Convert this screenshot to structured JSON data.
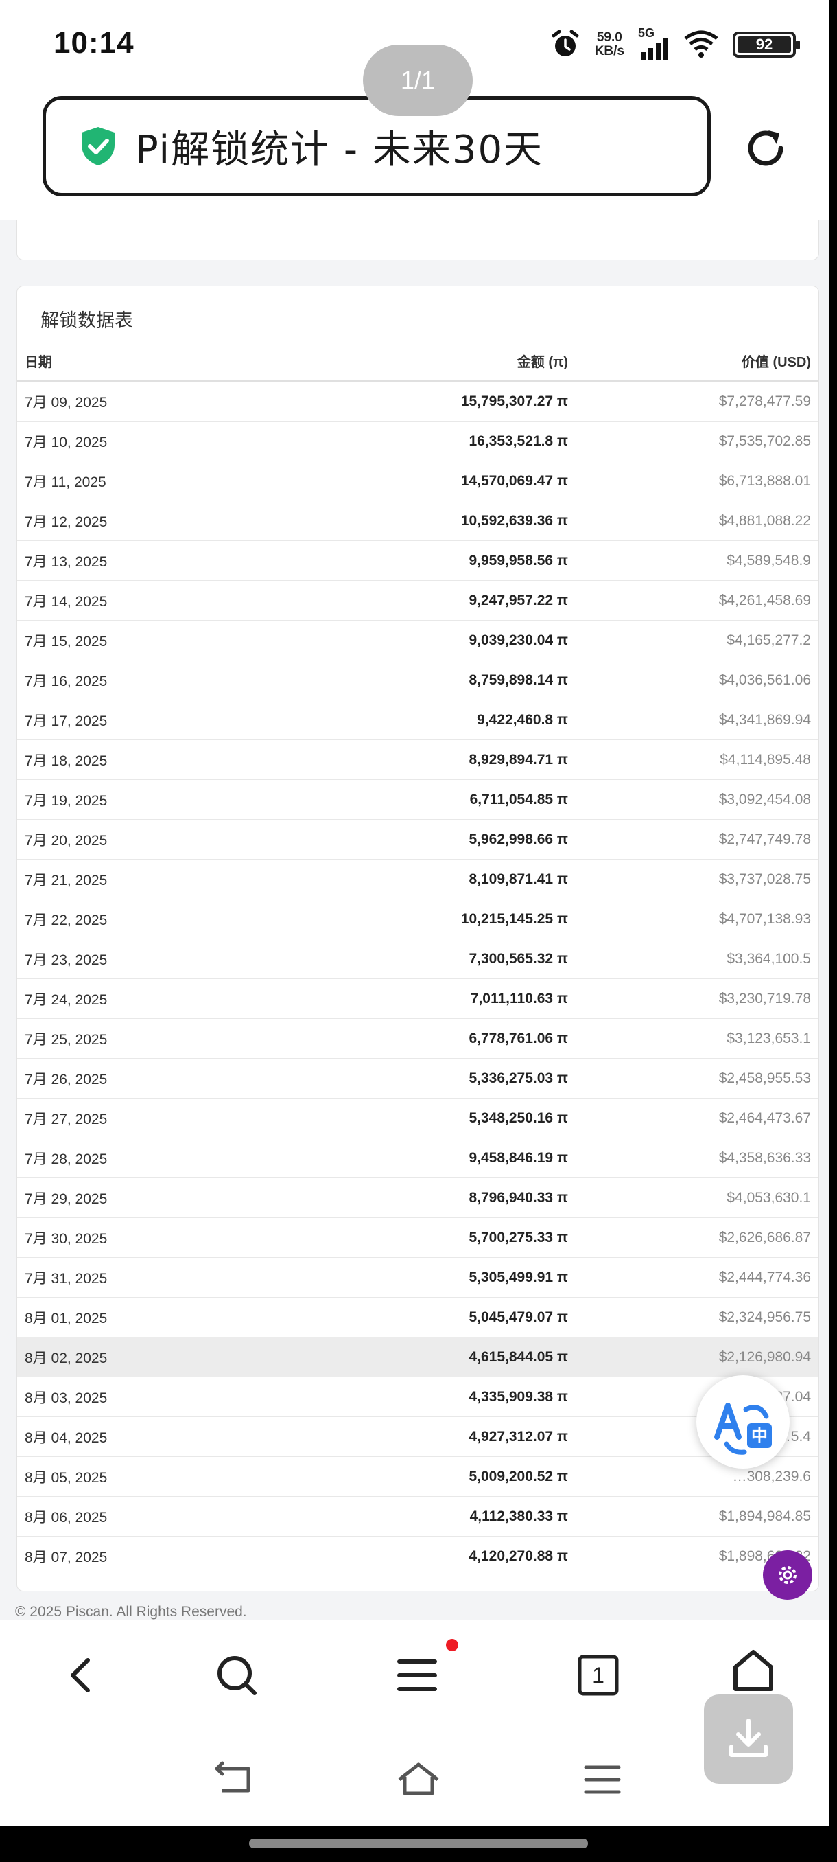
{
  "status_bar": {
    "time": "10:14",
    "net_speed_value": "59.0",
    "net_speed_unit": "KB/s",
    "network": "5G",
    "battery": "92"
  },
  "browser": {
    "page_counter": "1/1",
    "title": "Pi解锁统计 - 未来30天"
  },
  "table": {
    "title": "解锁数据表",
    "headers": [
      "日期",
      "金额 (π)",
      "价值 (USD)"
    ],
    "rows": [
      [
        "7月 09, 2025",
        "15,795,307.27 π",
        "$7,278,477.59"
      ],
      [
        "7月 10, 2025",
        "16,353,521.8 π",
        "$7,535,702.85"
      ],
      [
        "7月 11, 2025",
        "14,570,069.47 π",
        "$6,713,888.01"
      ],
      [
        "7月 12, 2025",
        "10,592,639.36 π",
        "$4,881,088.22"
      ],
      [
        "7月 13, 2025",
        "9,959,958.56 π",
        "$4,589,548.9"
      ],
      [
        "7月 14, 2025",
        "9,247,957.22 π",
        "$4,261,458.69"
      ],
      [
        "7月 15, 2025",
        "9,039,230.04 π",
        "$4,165,277.2"
      ],
      [
        "7月 16, 2025",
        "8,759,898.14 π",
        "$4,036,561.06"
      ],
      [
        "7月 17, 2025",
        "9,422,460.8 π",
        "$4,341,869.94"
      ],
      [
        "7月 18, 2025",
        "8,929,894.71 π",
        "$4,114,895.48"
      ],
      [
        "7月 19, 2025",
        "6,711,054.85 π",
        "$3,092,454.08"
      ],
      [
        "7月 20, 2025",
        "5,962,998.66 π",
        "$2,747,749.78"
      ],
      [
        "7月 21, 2025",
        "8,109,871.41 π",
        "$3,737,028.75"
      ],
      [
        "7月 22, 2025",
        "10,215,145.25 π",
        "$4,707,138.93"
      ],
      [
        "7月 23, 2025",
        "7,300,565.32 π",
        "$3,364,100.5"
      ],
      [
        "7月 24, 2025",
        "7,011,110.63 π",
        "$3,230,719.78"
      ],
      [
        "7月 25, 2025",
        "6,778,761.06 π",
        "$3,123,653.1"
      ],
      [
        "7月 26, 2025",
        "5,336,275.03 π",
        "$2,458,955.53"
      ],
      [
        "7月 27, 2025",
        "5,348,250.16 π",
        "$2,464,473.67"
      ],
      [
        "7月 28, 2025",
        "9,458,846.19 π",
        "$4,358,636.33"
      ],
      [
        "7月 29, 2025",
        "8,796,940.33 π",
        "$4,053,630.1"
      ],
      [
        "7月 30, 2025",
        "5,700,275.33 π",
        "$2,626,686.87"
      ],
      [
        "7月 31, 2025",
        "5,305,499.91 π",
        "$2,444,774.36"
      ],
      [
        "8月 01, 2025",
        "5,045,479.07 π",
        "$2,324,956.75"
      ],
      [
        "8月 02, 2025",
        "4,615,844.05 π",
        "$2,126,980.94"
      ],
      [
        "8月 03, 2025",
        "4,335,909.38 π",
        "…987.04"
      ],
      [
        "8月 04, 2025",
        "4,927,312.07 π",
        "…5.4"
      ],
      [
        "8月 05, 2025",
        "5,009,200.52 π",
        "…308,239.6"
      ],
      [
        "8月 06, 2025",
        "4,112,380.33 π",
        "$1,894,984.85"
      ],
      [
        "8月 07, 2025",
        "4,120,270.88 π",
        "$1,898,620.82"
      ]
    ],
    "highlighted_row_index": 24
  },
  "footer": {
    "text": "© 2025 Piscan. All Rights Reserved."
  },
  "bottom_nav": {
    "tab_count": "1",
    "menu_has_notification": true
  },
  "colors": {
    "shield": "#21b573",
    "gear_fab": "#7b1fa2",
    "translate_blue": "#2f80ed",
    "notification_dot": "#ee1c25",
    "highlight_row": "#ececec"
  },
  "icons": [
    "alarm-icon",
    "signal-icon",
    "wifi-icon",
    "battery-icon",
    "shield-check-icon",
    "reload-icon",
    "translate-icon",
    "gear-icon",
    "back-icon",
    "search-icon",
    "menu-icon",
    "tabs-icon",
    "home-icon",
    "download-icon",
    "system-back-icon",
    "system-home-icon",
    "system-recents-icon"
  ]
}
